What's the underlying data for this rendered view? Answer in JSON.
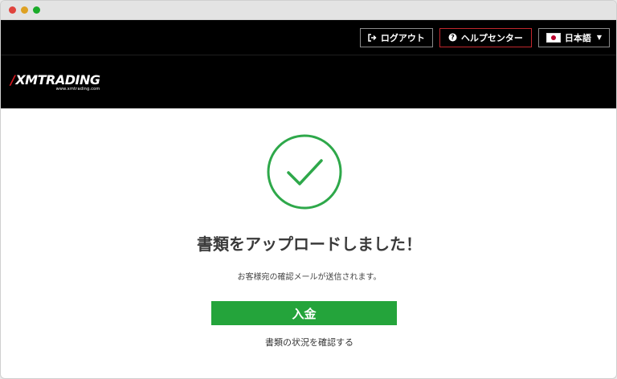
{
  "colors": {
    "top_bar": "#000000",
    "help_border": "#c1272d",
    "success_green": "#24a43b",
    "check_green": "#2ea84a",
    "logo_red": "#d71920"
  },
  "header": {
    "logout_label": "ログアウト",
    "help_label": "ヘルプセンター",
    "language_label": "日本語",
    "logout_icon": "logout-icon",
    "help_icon": "question-circle-icon",
    "language_icon": "japan-flag-icon"
  },
  "brand": {
    "logo_text": "XMTRADING",
    "logo_subtext": "www.xmtrading.com"
  },
  "main": {
    "status_icon": "checkmark-circle-icon",
    "title": "書類をアップロードしました！",
    "message": "お客様宛の確認メールが送信されます。",
    "deposit_label": "入金",
    "check_documents_link": "書類の状況を確認する"
  }
}
